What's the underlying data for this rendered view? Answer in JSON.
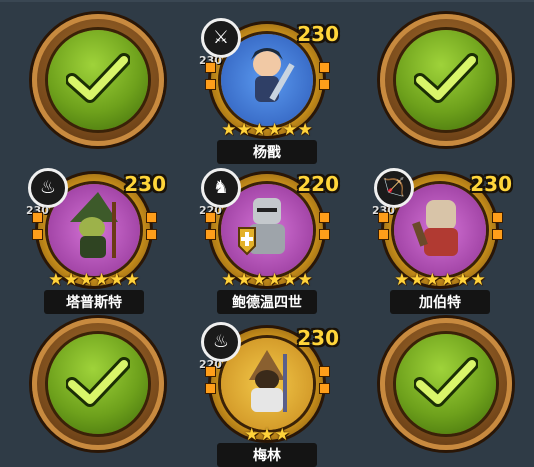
{
  "colors": {
    "background": "#2f3b46",
    "ring_gold": "#e5b12c",
    "check_green": "#8cc629",
    "power_text": "#ffd53a"
  },
  "empty_slot_icon": "checkmark-icon",
  "heroes": [
    {
      "name": "杨戬",
      "power": "230",
      "sub_power": "230",
      "class_icon": "sword-icon",
      "class_glyph": "⚔",
      "stars": 6,
      "bg": "#3b6fd0"
    },
    {
      "name": "塔普斯特",
      "power": "230",
      "sub_power": "230",
      "class_icon": "flame-icon",
      "class_glyph": "♨",
      "stars": 6,
      "bg": "#b04fb8"
    },
    {
      "name": "鲍德温四世",
      "power": "220",
      "sub_power": "220",
      "class_icon": "horse-icon",
      "class_glyph": "♞",
      "stars": 6,
      "bg": "#b04fb8"
    },
    {
      "name": "加伯特",
      "power": "230",
      "sub_power": "230",
      "class_icon": "bow-icon",
      "class_glyph": "🏹",
      "stars": 6,
      "bg": "#b04fb8"
    },
    {
      "name": "梅林",
      "power": "230",
      "sub_power": "220",
      "class_icon": "flame-icon",
      "class_glyph": "♨",
      "stars": 3,
      "bg": "#d9a02a"
    }
  ]
}
